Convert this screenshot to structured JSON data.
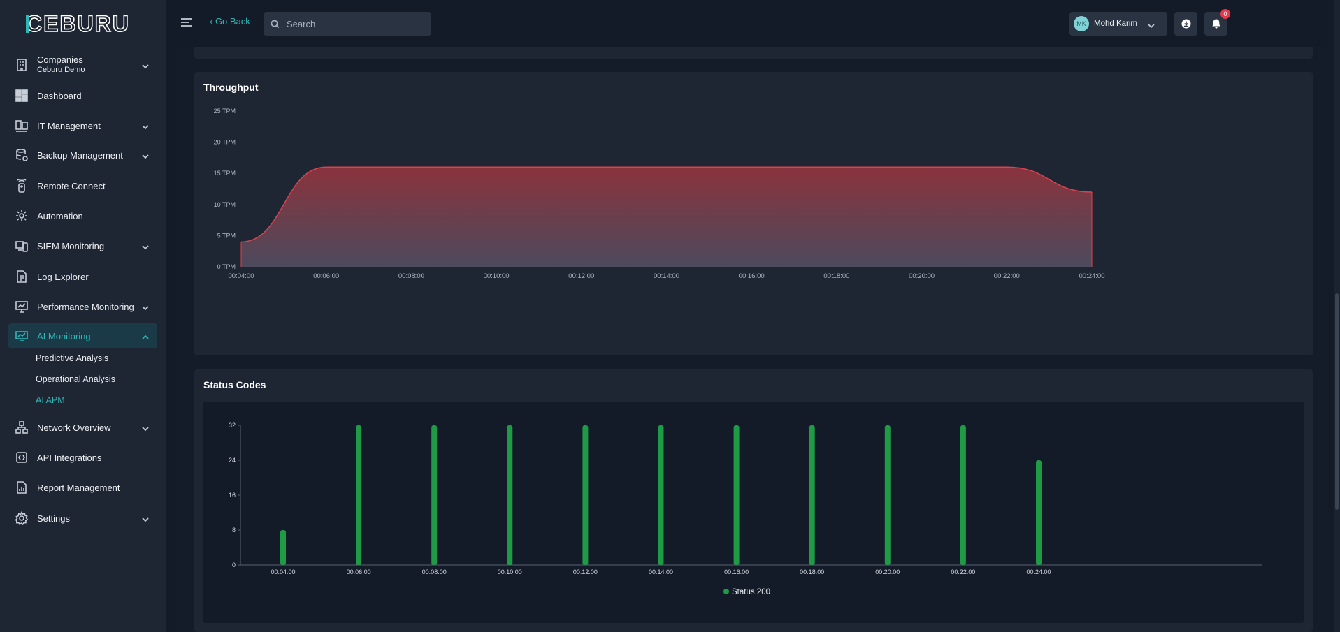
{
  "app": {
    "logo_text": "CEBURU",
    "brand_color": "#2fb7b7"
  },
  "topbar": {
    "go_back": "‹ Go Back",
    "search_placeholder": "Search",
    "notification_count": "0",
    "user_initials": "MK",
    "user_name": "Mohd Karim"
  },
  "sidebar": {
    "company_label": "Companies",
    "company_name": "Ceburu Demo",
    "items": [
      {
        "label": "Dashboard",
        "icon": "dashboard-icon"
      },
      {
        "label": "IT Management",
        "icon": "it-management-icon"
      },
      {
        "label": "Backup Management",
        "icon": "backup-icon"
      },
      {
        "label": "Remote Connect",
        "icon": "remote-icon"
      },
      {
        "label": "Automation",
        "icon": "automation-icon"
      },
      {
        "label": "SIEM Monitoring",
        "icon": "siem-icon"
      },
      {
        "label": "Log Explorer",
        "icon": "log-icon"
      },
      {
        "label": "Performance Monitoring",
        "icon": "performance-icon"
      },
      {
        "label": "AI Monitoring",
        "icon": "ai-monitoring-icon"
      },
      {
        "label": "Network Overview",
        "icon": "network-icon"
      },
      {
        "label": "API Integrations",
        "icon": "api-icon"
      },
      {
        "label": "Report Management",
        "icon": "report-icon"
      },
      {
        "label": "Settings",
        "icon": "gear-icon"
      }
    ],
    "ai_subitems": [
      "Predictive Analysis",
      "Operational Analysis",
      "AI APM"
    ]
  },
  "throughput": {
    "title": "Throughput"
  },
  "status_codes": {
    "title": "Status Codes"
  },
  "chart_data": [
    {
      "type": "area",
      "title": "Throughput",
      "x": [
        "00:04:00",
        "00:06:00",
        "00:08:00",
        "00:10:00",
        "00:12:00",
        "00:14:00",
        "00:16:00",
        "00:18:00",
        "00:20:00",
        "00:22:00",
        "00:24:00"
      ],
      "values": [
        4,
        16,
        16,
        16,
        16,
        16,
        16,
        16,
        16,
        16,
        12
      ],
      "yticks": [
        "0 TPM",
        "5 TPM",
        "10 TPM",
        "15 TPM",
        "20 TPM",
        "25 TPM"
      ],
      "ylim": [
        0,
        25
      ],
      "color": "#d9434e",
      "grid": false
    },
    {
      "type": "bar",
      "title": "Status Codes",
      "categories": [
        "00:04:00",
        "00:06:00",
        "00:08:00",
        "00:10:00",
        "00:12:00",
        "00:14:00",
        "00:16:00",
        "00:18:00",
        "00:20:00",
        "00:22:00",
        "00:24:00"
      ],
      "series": [
        {
          "name": "Status 200",
          "values": [
            8,
            32,
            32,
            32,
            32,
            32,
            32,
            32,
            32,
            32,
            24
          ],
          "color": "#1f9a45"
        }
      ],
      "yticks": [
        "0",
        "8",
        "16",
        "24",
        "32"
      ],
      "ylim": [
        0,
        32
      ],
      "legend": "bottom-center",
      "grid": false
    }
  ]
}
